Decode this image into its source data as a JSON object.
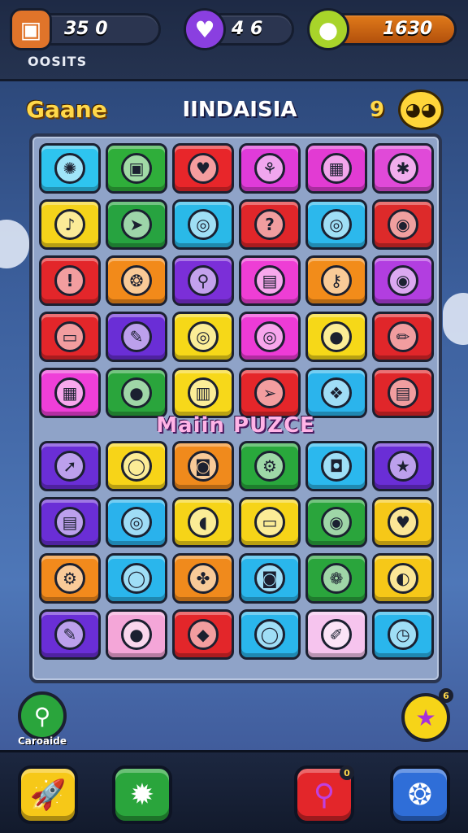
{
  "topbar": {
    "currency1": {
      "value": "35 0",
      "icon": "backpack-icon"
    },
    "currency2": {
      "value": "4 6",
      "icon": "gem-icon"
    },
    "currency3": {
      "value": "1630",
      "icon": "coin-icon"
    },
    "subtitle": "OOSITS"
  },
  "header": {
    "game_title": "Gaane",
    "level_title": "IINDAISIA",
    "count": "9",
    "mascot": "sun-mascot-icon"
  },
  "board": {
    "section_title": "Maiin PUZCE",
    "top_tiles": [
      {
        "color": "#2ec4ef",
        "icon": "yarn-ball-icon",
        "glyph": "✺"
      },
      {
        "color": "#2fae3a",
        "icon": "picture-icon",
        "glyph": "▣"
      },
      {
        "color": "#e8262a",
        "icon": "heart-icon",
        "glyph": "♥"
      },
      {
        "color": "#e03bd9",
        "icon": "tulip-icon",
        "glyph": "⚘"
      },
      {
        "color": "#e23bd3",
        "icon": "toaster-icon",
        "glyph": "▦"
      },
      {
        "color": "#e04ad8",
        "icon": "star-blob-icon",
        "glyph": "✱"
      },
      {
        "color": "#f5d31a",
        "icon": "music-note-icon",
        "glyph": "♪"
      },
      {
        "color": "#27a340",
        "icon": "arrow-icon",
        "glyph": "➤"
      },
      {
        "color": "#2ab9e8",
        "icon": "ring-icon",
        "glyph": "◎"
      },
      {
        "color": "#e0262a",
        "icon": "question-icon",
        "glyph": "?"
      },
      {
        "color": "#2cb8ec",
        "icon": "ring-icon",
        "glyph": "◎"
      },
      {
        "color": "#dd2a2a",
        "icon": "spiral-icon",
        "glyph": "◉"
      },
      {
        "color": "#e3262a",
        "icon": "exclamation-icon",
        "glyph": "!"
      },
      {
        "color": "#f28a1a",
        "icon": "swirl-icon",
        "glyph": "❂"
      },
      {
        "color": "#7b2fd8",
        "icon": "magnifier-icon",
        "glyph": "⚲"
      },
      {
        "color": "#ee3ed5",
        "icon": "clipboard-icon",
        "glyph": "▤"
      },
      {
        "color": "#f28c1a",
        "icon": "key-icon",
        "glyph": "⚷"
      },
      {
        "color": "#b23ee0",
        "icon": "eye-icon",
        "glyph": "◉"
      },
      {
        "color": "#e3262a",
        "icon": "cassette-icon",
        "glyph": "▭"
      },
      {
        "color": "#6a2ed6",
        "icon": "pencil-icon",
        "glyph": "✎"
      },
      {
        "color": "#f6d818",
        "icon": "ring-icon",
        "glyph": "◎"
      },
      {
        "color": "#ed3bd6",
        "icon": "target-icon",
        "glyph": "◎"
      },
      {
        "color": "#f6d818",
        "icon": "ring-icon",
        "glyph": "●"
      },
      {
        "color": "#e0262a",
        "icon": "pen-icon",
        "glyph": "✏"
      },
      {
        "color": "#ef3fd8",
        "icon": "radio-icon",
        "glyph": "▦"
      },
      {
        "color": "#2aa53c",
        "icon": "lemon-icon",
        "glyph": "●"
      },
      {
        "color": "#f7d81a",
        "icon": "box-icon",
        "glyph": "▥"
      },
      {
        "color": "#e5262a",
        "icon": "paper-plane-icon",
        "glyph": "➢"
      },
      {
        "color": "#2bb4ec",
        "icon": "blob-icon",
        "glyph": "❖"
      },
      {
        "color": "#e0262a",
        "icon": "printer-icon",
        "glyph": "▤"
      }
    ],
    "bottom_tiles": [
      {
        "color": "#6a2ed6",
        "icon": "arrow-icon",
        "glyph": "➚"
      },
      {
        "color": "#f7d418",
        "icon": "ring-icon",
        "glyph": "◯"
      },
      {
        "color": "#f08a1c",
        "icon": "camera-icon",
        "glyph": "◙"
      },
      {
        "color": "#29a83c",
        "icon": "gear-icon",
        "glyph": "⚙"
      },
      {
        "color": "#2bb8ee",
        "icon": "bag-icon",
        "glyph": "◘"
      },
      {
        "color": "#6a2ed6",
        "icon": "star-icon",
        "glyph": "★"
      },
      {
        "color": "#6a2ed6",
        "icon": "notepad-icon",
        "glyph": "▤"
      },
      {
        "color": "#2ab2ec",
        "icon": "swirl-icon",
        "glyph": "◎"
      },
      {
        "color": "#f6d418",
        "icon": "bell-icon",
        "glyph": "◖"
      },
      {
        "color": "#f6d418",
        "icon": "battery-icon",
        "glyph": "▭"
      },
      {
        "color": "#2aa53c",
        "icon": "button-icon",
        "glyph": "◉"
      },
      {
        "color": "#f6c818",
        "icon": "heart-icon",
        "glyph": "♥"
      },
      {
        "color": "#f28a1c",
        "icon": "gear-icon",
        "glyph": "⚙"
      },
      {
        "color": "#2ab6ec",
        "icon": "ring-icon",
        "glyph": "◯"
      },
      {
        "color": "#f08a1c",
        "icon": "leaf-icon",
        "glyph": "✤"
      },
      {
        "color": "#2ab6ec",
        "icon": "camera-icon",
        "glyph": "◙"
      },
      {
        "color": "#2aa53c",
        "icon": "gear-icon",
        "glyph": "❁"
      },
      {
        "color": "#f6c818",
        "icon": "tape-icon",
        "glyph": "◐"
      },
      {
        "color": "#6a2ed6",
        "icon": "pencil-icon",
        "glyph": "✎"
      },
      {
        "color": "#f4a6d8",
        "icon": "ladybug-icon",
        "glyph": "●"
      },
      {
        "color": "#e3262a",
        "icon": "diamond-icon",
        "glyph": "◆"
      },
      {
        "color": "#2ab6ec",
        "icon": "ring-icon",
        "glyph": "◯"
      },
      {
        "color": "#f6c4ee",
        "icon": "brush-icon",
        "glyph": "✐"
      },
      {
        "color": "#2ab6ec",
        "icon": "clock-icon",
        "glyph": "◷"
      }
    ]
  },
  "side": {
    "left_label": "Caroaide",
    "left_icon": "magnifier-icon",
    "right_icon": "star-icon",
    "right_badge": "6"
  },
  "bottombar": {
    "btn1": {
      "icon": "rocket-icon",
      "color": "#f6c818"
    },
    "btn2": {
      "icon": "bomb-icon",
      "color": "#2aa53c"
    },
    "btn3": {
      "icon": "magnifier-icon",
      "color": "#e3262a",
      "badge": "0"
    },
    "btn4": {
      "icon": "settings-icon",
      "color": "#2f6ed8"
    }
  }
}
